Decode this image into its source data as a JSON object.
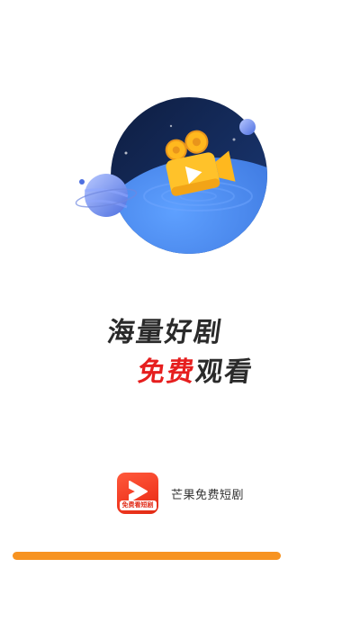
{
  "splash": {
    "slogan_line1": "海量好剧",
    "slogan_line2_highlight": "免费",
    "slogan_line2_rest": "观看"
  },
  "brand": {
    "app_name": "芒果免费短剧",
    "icon_label": "免费看短剧",
    "icon_name": "play-arrow-icon"
  },
  "loading": {
    "progress": 0.8
  },
  "illustration": {
    "icon_name": "movie-camera-icon"
  },
  "colors": {
    "accent_orange": "#f79321",
    "highlight_red": "#e61e1e",
    "circle_dark": "#142a55",
    "planet_blue": "#3f7fe0",
    "camera_yellow": "#ffb81e",
    "icon_red": "#f23a22"
  }
}
